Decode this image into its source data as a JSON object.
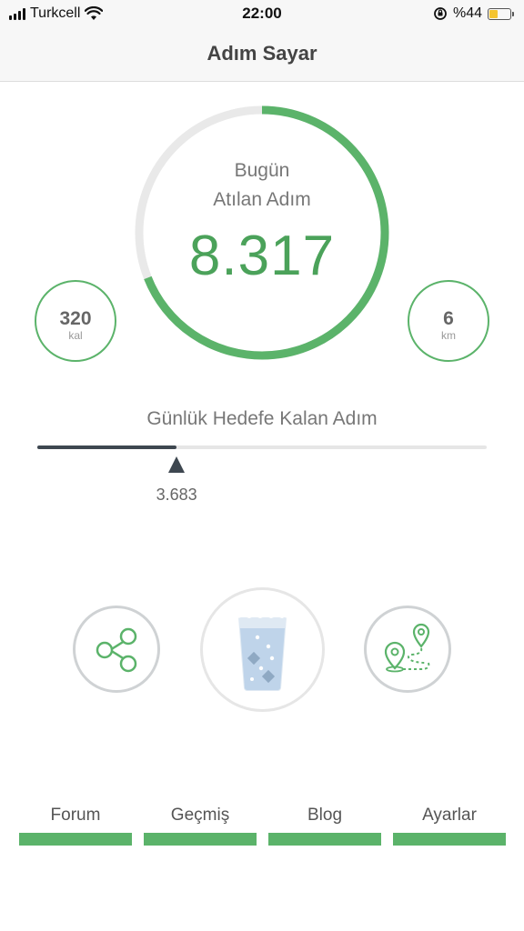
{
  "status_bar": {
    "carrier": "Turkcell",
    "time": "22:00",
    "battery_text": "%44",
    "battery_level": 0.44,
    "icons": [
      "signal-icon",
      "wifi-icon",
      "rotation-lock-icon",
      "battery-icon"
    ]
  },
  "nav": {
    "title": "Adım Sayar"
  },
  "today": {
    "line1": "Bugün",
    "line2": "Atılan Adım",
    "steps": "8.317",
    "progress": 0.69
  },
  "stats": {
    "calories": {
      "value": "320",
      "unit": "kal"
    },
    "distance": {
      "value": "6",
      "unit": "km"
    }
  },
  "goal": {
    "title": "Günlük Hedefe Kalan Adım",
    "remaining": "3.683",
    "progress": 0.31
  },
  "actions": {
    "share": {
      "icon": "share-icon"
    },
    "water": {
      "icon": "water-glass-icon"
    },
    "map": {
      "icon": "map-route-icon"
    }
  },
  "tabs": [
    {
      "label": "Forum"
    },
    {
      "label": "Geçmiş"
    },
    {
      "label": "Blog"
    },
    {
      "label": "Ayarlar"
    }
  ],
  "colors": {
    "accent": "#5bb36a",
    "value_text": "#4ba25a",
    "dark": "#3e4750",
    "track": "#e6e6e6"
  }
}
